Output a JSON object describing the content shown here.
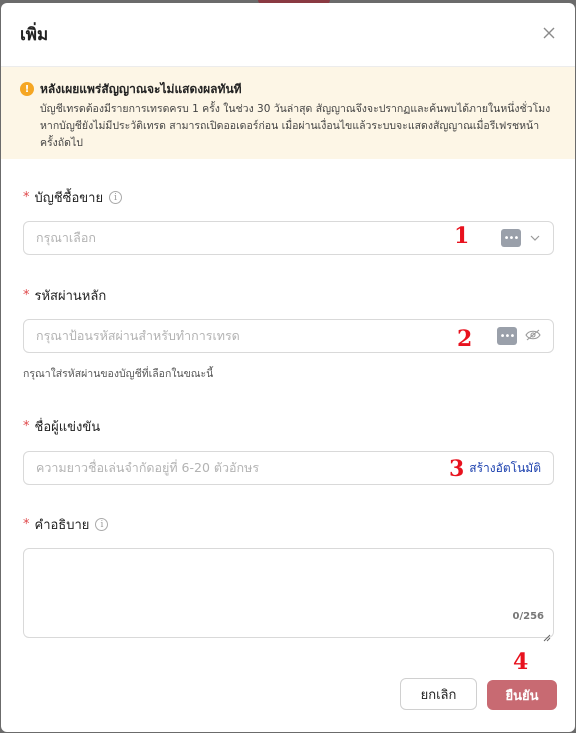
{
  "modal": {
    "title": "เพิ่ม"
  },
  "alert": {
    "title": "หลังเผยแพร่สัญญาณจะไม่แสดงผลทันที",
    "line1": "บัญชีเทรดต้องมีรายการเทรดครบ 1 ครั้ง ในช่วง 30 วันล่าสุด สัญญาณจึงจะปรากฏและค้นพบได้ภายในหนึ่งชั่วโมง",
    "line2": "หากบัญชียังไม่มีประวัติเทรด สามารถเปิดออเดอร์ก่อน เมื่อผ่านเงื่อนไขแล้วระบบจะแสดงสัญญาณเมื่อรีเฟรชหน้า",
    "line3": "ครั้งถัดไป"
  },
  "fields": {
    "account": {
      "label": "บัญชีซื้อขาย",
      "placeholder": "กรุณาเลือก",
      "badge": "1"
    },
    "password": {
      "label": "รหัสผ่านหลัก",
      "placeholder": "กรุณาป้อนรหัสผ่านสำหรับทำการเทรด",
      "help": "กรุณาใส่รหัสผ่านของบัญชีที่เลือกในขณะนี้",
      "badge": "2"
    },
    "contestant": {
      "label": "ชื่อผู้แข่งขัน",
      "placeholder": "ความยาวชื่อเล่นจำกัดอยู่ที่ 6-20 ตัวอักษร",
      "auto_generate": "สร้างอัตโนมัติ",
      "badge": "3"
    },
    "description": {
      "label": "คำอธิบาย",
      "counter": "0/256"
    }
  },
  "footer": {
    "cancel_label": "ยกเลิก",
    "confirm_label": "ยืนยัน",
    "badge": "4"
  },
  "colors": {
    "confirm_bg": "#c86a72",
    "alert_bg": "#fdf6e6",
    "required": "#e0484a",
    "badge_red": "#e8121e",
    "link_blue": "#1a3fae"
  }
}
